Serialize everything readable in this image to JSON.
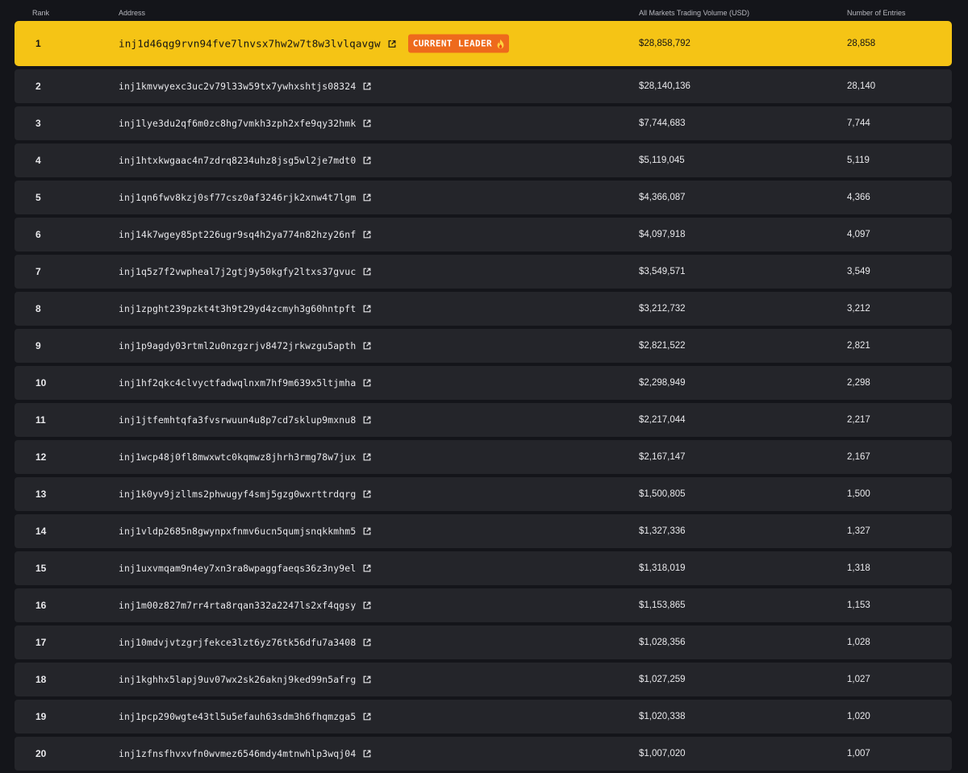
{
  "header": {
    "rank": "Rank",
    "address": "Address",
    "volume": "All Markets Trading Volume (USD)",
    "entries": "Number of Entries"
  },
  "leader_badge": "CURRENT LEADER",
  "icons": {
    "external_link": "external-link-icon",
    "flame": "flame-icon"
  },
  "colors": {
    "background": "#14151a",
    "row": "#24252a",
    "leader_row": "#f5c415",
    "badge": "#ee6a1c"
  },
  "rows": [
    {
      "rank": "1",
      "address": "inj1d46qg9rvn94fve7lnvsx7hw2w7t8w3lvlqavgw",
      "volume": "$28,858,792",
      "entries": "28,858"
    },
    {
      "rank": "2",
      "address": "inj1kmvwyexc3uc2v79l33w59tx7ywhxshtjs08324",
      "volume": "$28,140,136",
      "entries": "28,140"
    },
    {
      "rank": "3",
      "address": "inj1lye3du2qf6m0zc8hg7vmkh3zph2xfe9qy32hmk",
      "volume": "$7,744,683",
      "entries": "7,744"
    },
    {
      "rank": "4",
      "address": "inj1htxkwgaac4n7zdrq8234uhz8jsg5wl2je7mdt0",
      "volume": "$5,119,045",
      "entries": "5,119"
    },
    {
      "rank": "5",
      "address": "inj1qn6fwv8kzj0sf77csz0af3246rjk2xnw4t7lgm",
      "volume": "$4,366,087",
      "entries": "4,366"
    },
    {
      "rank": "6",
      "address": "inj14k7wgey85pt226ugr9sq4h2ya774n82hzy26nf",
      "volume": "$4,097,918",
      "entries": "4,097"
    },
    {
      "rank": "7",
      "address": "inj1q5z7f2vwpheal7j2gtj9y50kgfy2ltxs37gvuc",
      "volume": "$3,549,571",
      "entries": "3,549"
    },
    {
      "rank": "8",
      "address": "inj1zpght239pzkt4t3h9t29yd4zcmyh3g60hntpft",
      "volume": "$3,212,732",
      "entries": "3,212"
    },
    {
      "rank": "9",
      "address": "inj1p9agdy03rtml2u0nzgzrjv8472jrkwzgu5apth",
      "volume": "$2,821,522",
      "entries": "2,821"
    },
    {
      "rank": "10",
      "address": "inj1hf2qkc4clvyctfadwqlnxm7hf9m639x5ltjmha",
      "volume": "$2,298,949",
      "entries": "2,298"
    },
    {
      "rank": "11",
      "address": "inj1jtfemhtqfa3fvsrwuun4u8p7cd7sklup9mxnu8",
      "volume": "$2,217,044",
      "entries": "2,217"
    },
    {
      "rank": "12",
      "address": "inj1wcp48j0fl8mwxwtc0kqmwz8jhrh3rmg78w7jux",
      "volume": "$2,167,147",
      "entries": "2,167"
    },
    {
      "rank": "13",
      "address": "inj1k0yv9jzllms2phwugyf4smj5gzg0wxrttrdqrg",
      "volume": "$1,500,805",
      "entries": "1,500"
    },
    {
      "rank": "14",
      "address": "inj1vldp2685n8gwynpxfnmv6ucn5qumjsnqkkmhm5",
      "volume": "$1,327,336",
      "entries": "1,327"
    },
    {
      "rank": "15",
      "address": "inj1uxvmqam9n4ey7xn3ra8wpaggfaeqs36z3ny9el",
      "volume": "$1,318,019",
      "entries": "1,318"
    },
    {
      "rank": "16",
      "address": "inj1m00z827m7rr4rta8rqan332a2247ls2xf4qgsy",
      "volume": "$1,153,865",
      "entries": "1,153"
    },
    {
      "rank": "17",
      "address": "inj10mdvjvtzgrjfekce3lzt6yz76tk56dfu7a3408",
      "volume": "$1,028,356",
      "entries": "1,028"
    },
    {
      "rank": "18",
      "address": "inj1kghhx5lapj9uv07wx2sk26aknj9ked99n5afrg",
      "volume": "$1,027,259",
      "entries": "1,027"
    },
    {
      "rank": "19",
      "address": "inj1pcp290wgte43tl5u5efauh63sdm3h6fhqmzga5",
      "volume": "$1,020,338",
      "entries": "1,020"
    },
    {
      "rank": "20",
      "address": "inj1zfnsfhvxvfn0wvmez6546mdy4mtnwhlp3wqj04",
      "volume": "$1,007,020",
      "entries": "1,007"
    }
  ]
}
